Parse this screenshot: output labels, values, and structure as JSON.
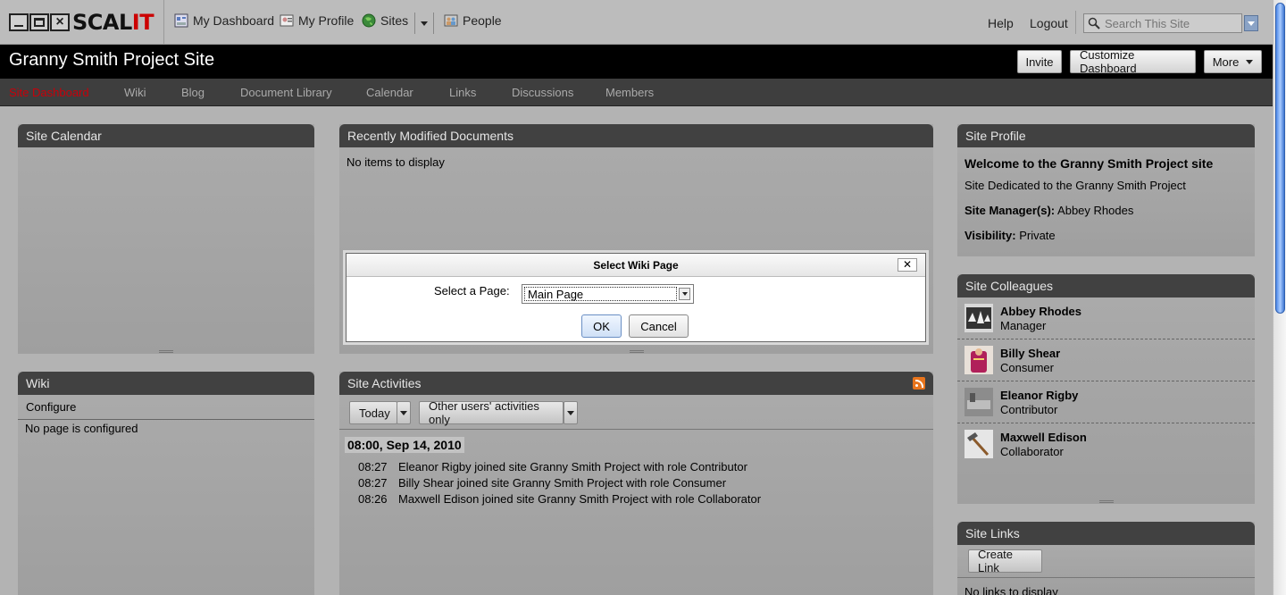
{
  "app": {
    "logo_text_a": "SCAL",
    "logo_text_b": "IT"
  },
  "topnav": {
    "items": [
      {
        "label": "My Dashboard",
        "icon": "dashboard-icon"
      },
      {
        "label": "My Profile",
        "icon": "profile-icon"
      },
      {
        "label": "Sites",
        "icon": "sites-globe-icon"
      },
      {
        "label": "People",
        "icon": "people-icon"
      }
    ],
    "help": "Help",
    "logout": "Logout",
    "search_placeholder": "Search This Site"
  },
  "header": {
    "site_title": "Granny Smith Project Site",
    "invite": "Invite",
    "customize": "Customize Dashboard",
    "more": "More"
  },
  "tabs": [
    {
      "label": "Site Dashboard",
      "active": true
    },
    {
      "label": "Wiki"
    },
    {
      "label": "Blog"
    },
    {
      "label": "Document Library"
    },
    {
      "label": "Calendar"
    },
    {
      "label": "Links"
    },
    {
      "label": "Discussions"
    },
    {
      "label": "Members"
    }
  ],
  "dashlets": {
    "calendar": {
      "title": "Site Calendar"
    },
    "recent_docs": {
      "title": "Recently Modified Documents",
      "empty": "No items to display"
    },
    "wiki": {
      "title": "Wiki",
      "configure": "Configure",
      "empty": "No page is configured"
    },
    "activities": {
      "title": "Site Activities",
      "filter_time": "Today",
      "filter_users": "Other users' activities only",
      "date_heading": "08:00, Sep 14, 2010",
      "entries": [
        {
          "time": "08:27",
          "text": "Eleanor Rigby joined site Granny Smith Project with role Contributor"
        },
        {
          "time": "08:27",
          "text": "Billy Shear joined site Granny Smith Project with role Consumer"
        },
        {
          "time": "08:26",
          "text": "Maxwell Edison joined site Granny Smith Project with role Collaborator"
        }
      ]
    },
    "profile": {
      "title": "Site Profile",
      "welcome": "Welcome to the Granny Smith Project site",
      "description": "Site Dedicated to the Granny Smith Project",
      "managers_label": "Site Manager(s):",
      "managers_value": "Abbey Rhodes",
      "visibility_label": "Visibility:",
      "visibility_value": "Private"
    },
    "colleagues": {
      "title": "Site Colleagues",
      "people": [
        {
          "name": "Abbey Rhodes",
          "role": "Manager"
        },
        {
          "name": "Billy Shear",
          "role": "Consumer"
        },
        {
          "name": "Eleanor Rigby",
          "role": "Contributor"
        },
        {
          "name": "Maxwell Edison",
          "role": "Collaborator"
        }
      ]
    },
    "links": {
      "title": "Site Links",
      "create": "Create Link",
      "empty": "No links to display"
    }
  },
  "modal": {
    "title": "Select Wiki Page",
    "close": "✕",
    "label": "Select a Page:",
    "selected": "Main Page",
    "ok": "OK",
    "cancel": "Cancel"
  },
  "colors": {
    "active_tab": "#c8000a",
    "dashlet_header": "#414141",
    "rss": "#e8741c"
  }
}
